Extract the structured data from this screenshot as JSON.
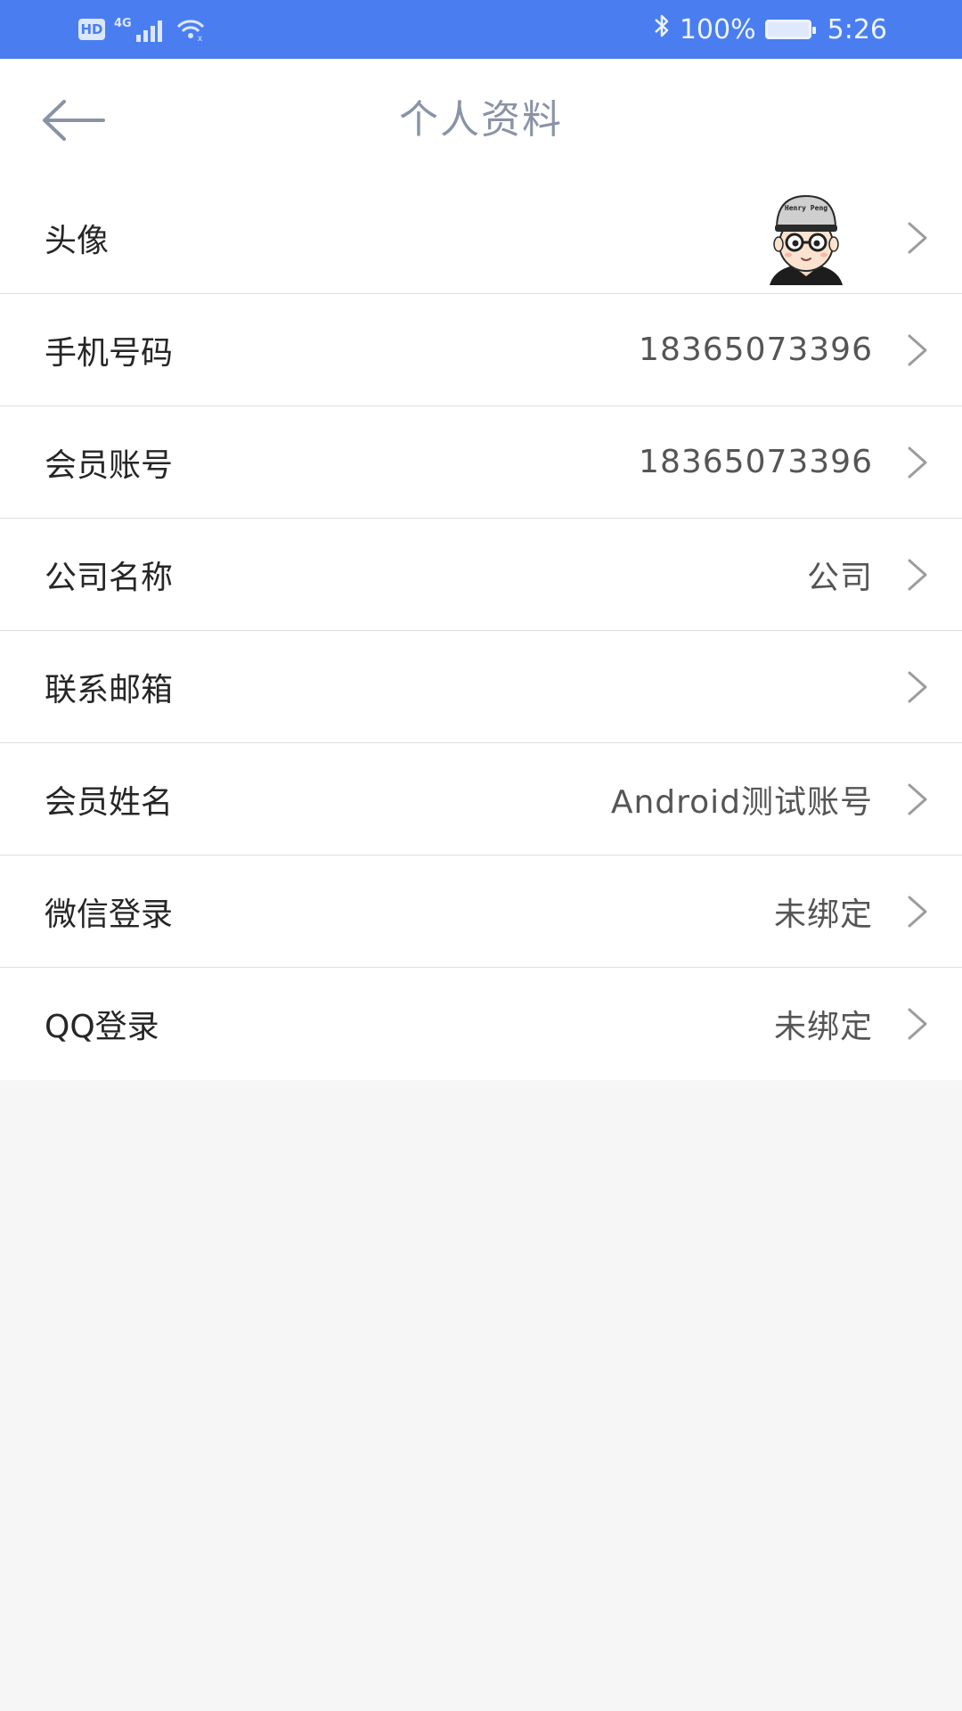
{
  "status_bar": {
    "hd_label": "HD",
    "network_label": "4G",
    "battery_percent": "100%",
    "time": "5:26",
    "icons": [
      "hd-icon",
      "signal-icon",
      "wifi-icon",
      "bluetooth-icon",
      "battery-icon"
    ]
  },
  "header": {
    "title": "个人资料",
    "back_icon": "back-arrow-icon"
  },
  "rows": [
    {
      "label": "头像",
      "value": "",
      "type": "avatar",
      "avatar_text": "Henry Peng"
    },
    {
      "label": "手机号码",
      "value": "18365073396"
    },
    {
      "label": "会员账号",
      "value": "18365073396"
    },
    {
      "label": "公司名称",
      "value": "公司"
    },
    {
      "label": "联系邮箱",
      "value": ""
    },
    {
      "label": "会员姓名",
      "value": "Android测试账号"
    },
    {
      "label": "微信登录",
      "value": "未绑定"
    },
    {
      "label": "QQ登录",
      "value": "未绑定"
    }
  ],
  "colors": {
    "status_bar": "#4a7ef0",
    "title_text": "#8a93a6",
    "background": "#f6f6f6",
    "divider": "#dedede"
  }
}
